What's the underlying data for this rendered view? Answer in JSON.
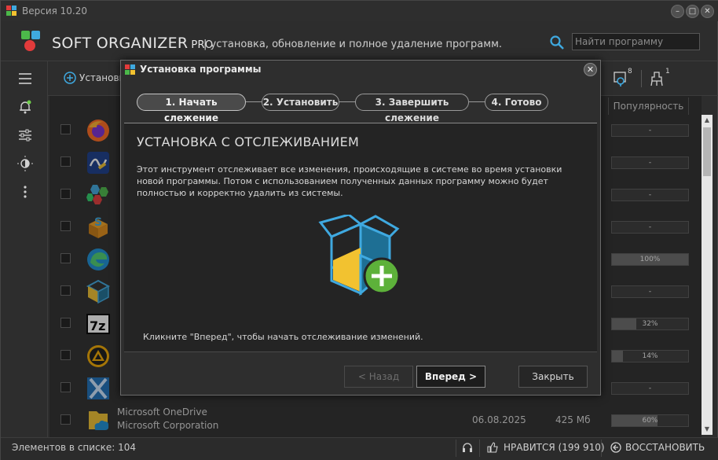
{
  "window": {
    "title": "Версия 10.20"
  },
  "header": {
    "brand": "SOFT ORGANIZER",
    "brand_edition": "PRO",
    "tagline": "| установка, обновление и полное удаление программ.",
    "search_placeholder": "Найти программу"
  },
  "toolbar": {
    "add_label": "Установить",
    "tracked_badge": "8",
    "cleaner_badge": "1",
    "popularity_header": "Популярность"
  },
  "list": {
    "rows": [
      {
        "icon": "firefox-icon",
        "popularity": "-",
        "pop_pct": 0
      },
      {
        "icon": "signature-icon",
        "popularity": "-",
        "pop_pct": 0
      },
      {
        "icon": "hexagons-icon",
        "popularity": "-",
        "pop_pct": 0
      },
      {
        "icon": "box-s-icon",
        "popularity": "-",
        "pop_pct": 0
      },
      {
        "icon": "edge-icon",
        "popularity": "100%",
        "pop_pct": 100
      },
      {
        "icon": "cube-icon",
        "popularity": "-",
        "pop_pct": 0
      },
      {
        "icon": "7zip-icon",
        "popularity": "32%",
        "pop_pct": 32
      },
      {
        "icon": "aimp-icon",
        "popularity": "14%",
        "pop_pct": 14
      },
      {
        "icon": "x-logo-icon",
        "popularity": "-",
        "pop_pct": 0
      },
      {
        "icon": "onedrive-icon",
        "name": "Microsoft OneDrive",
        "publisher": "Microsoft Corporation",
        "date": "06.08.2025",
        "size": "425 Мб",
        "popularity": "60%",
        "pop_pct": 60
      }
    ]
  },
  "statusbar": {
    "count": "Элементов в списке: 104",
    "like": "НРАВИТСЯ (199 910)",
    "restore": "ВОССТАНОВИТЬ"
  },
  "dialog": {
    "title": "Установка программы",
    "steps": [
      "1. Начать слежение",
      "2. Установить",
      "3. Завершить слежение",
      "4. Готово"
    ],
    "heading": "УСТАНОВКА С ОТСЛЕЖИВАНИЕМ",
    "description": "Этот инструмент отслеживает все изменения, происходящие в системе во время установки новой программы. Потом с использованием полученных данных программу можно будет полностью и корректно удалить из системы.",
    "hint": "Кликните \"Вперед\", чтобы начать отслеживание изменений.",
    "back_label": "< Назад",
    "next_label": "Вперед >",
    "close_label": "Закрыть"
  }
}
